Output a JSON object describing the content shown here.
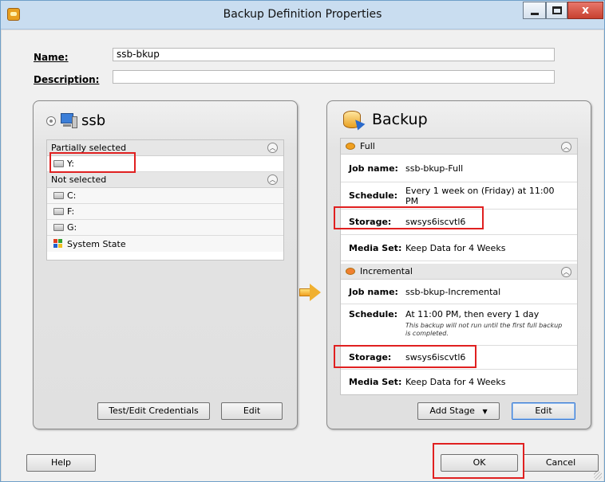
{
  "window": {
    "title": "Backup Definition Properties",
    "close_glyph": "x"
  },
  "fields": {
    "name_label": "Name:",
    "name_value": "ssb-bkup",
    "description_label": "Description:",
    "description_value": ""
  },
  "source_panel": {
    "title": "ssb",
    "groups": [
      {
        "label": "Partially selected",
        "items": [
          {
            "label": "Y:",
            "icon": "drive-icon"
          }
        ]
      },
      {
        "label": "Not selected",
        "items": [
          {
            "label": "C:",
            "icon": "drive-icon"
          },
          {
            "label": "F:",
            "icon": "drive-icon"
          },
          {
            "label": "G:",
            "icon": "drive-icon"
          },
          {
            "label": "System State",
            "icon": "system-state-icon"
          }
        ]
      }
    ],
    "test_credentials_label": "Test/Edit Credentials",
    "edit_label": "Edit"
  },
  "backup_panel": {
    "title": "Backup",
    "stages": [
      {
        "name": "Full",
        "job_name_label": "Job name:",
        "job_name": "ssb-bkup-Full",
        "schedule_label": "Schedule:",
        "schedule": "Every 1 week on (Friday) at 11:00 PM",
        "schedule_note": "",
        "storage_label": "Storage:",
        "storage": "swsys6iscvtl6",
        "media_set_label": "Media Set:",
        "media_set": "Keep Data for 4 Weeks"
      },
      {
        "name": "Incremental",
        "job_name_label": "Job name:",
        "job_name": "ssb-bkup-Incremental",
        "schedule_label": "Schedule:",
        "schedule": "At 11:00 PM, then every 1 day",
        "schedule_note": "This backup will not run until the first full backup is completed.",
        "storage_label": "Storage:",
        "storage": "swsys6iscvtl6",
        "media_set_label": "Media Set:",
        "media_set": "Keep Data for 4 Weeks"
      }
    ],
    "add_stage_label": "Add Stage",
    "edit_label": "Edit"
  },
  "footer": {
    "help_label": "Help",
    "ok_label": "OK",
    "cancel_label": "Cancel"
  },
  "colors": {
    "highlight": "#e02020",
    "accent": "#3a7bd5"
  }
}
